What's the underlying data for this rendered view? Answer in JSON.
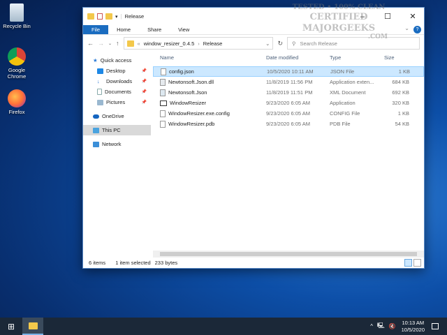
{
  "desktop": {
    "icons": [
      {
        "label": "Recycle Bin"
      },
      {
        "label": "Google Chrome"
      },
      {
        "label": "Firefox"
      }
    ]
  },
  "window": {
    "title": "Release",
    "ribbon_tabs": [
      "File",
      "Home",
      "Share",
      "View"
    ],
    "address": {
      "segments": [
        "window_resizer_0.4.5",
        "Release"
      ],
      "overflow": "«"
    },
    "search_placeholder": "Search Release",
    "nav": [
      {
        "label": "Quick access",
        "icon": "star-icon"
      },
      {
        "label": "Desktop",
        "icon": "desktop-icon",
        "pinned": true
      },
      {
        "label": "Downloads",
        "icon": "download-icon",
        "pinned": true
      },
      {
        "label": "Documents",
        "icon": "documents-icon",
        "pinned": true
      },
      {
        "label": "Pictures",
        "icon": "pictures-icon",
        "pinned": true
      },
      {
        "label": "OneDrive",
        "icon": "cloud-icon"
      },
      {
        "label": "This PC",
        "icon": "computer-icon",
        "selected": true
      },
      {
        "label": "Network",
        "icon": "network-icon"
      }
    ],
    "columns": [
      "Name",
      "Date modified",
      "Type",
      "Size"
    ],
    "files": [
      {
        "name": "config.json",
        "date": "10/5/2020 10:11 AM",
        "type": "JSON File",
        "size": "1 KB",
        "selected": true
      },
      {
        "name": "Newtonsoft.Json.dll",
        "date": "11/8/2019 11:56 PM",
        "type": "Application exten...",
        "size": "684 KB"
      },
      {
        "name": "Newtonsoft.Json",
        "date": "11/8/2019 11:51 PM",
        "type": "XML Document",
        "size": "692 KB"
      },
      {
        "name": "WindowResizer",
        "date": "9/23/2020 6:05 AM",
        "type": "Application",
        "size": "320 KB"
      },
      {
        "name": "WindowResizer.exe.config",
        "date": "9/23/2020 6:05 AM",
        "type": "CONFIG File",
        "size": "1 KB"
      },
      {
        "name": "WindowResizer.pdb",
        "date": "9/23/2020 6:05 AM",
        "type": "PDB File",
        "size": "54 KB"
      }
    ],
    "status": {
      "count": "6 items",
      "selection": "1 item selected",
      "size": "233 bytes"
    }
  },
  "watermark": {
    "line1": "TESTED • 100% CLEAN",
    "line2": "CERTIFIED",
    "line3": "MAJORGEEKS",
    "line4": ".COM"
  },
  "taskbar": {
    "time": "10:13 AM",
    "date": "10/5/2020"
  },
  "colors": {
    "accent": "#1a6cc0",
    "selection": "#cce8ff",
    "taskbar": "#1b2838"
  }
}
